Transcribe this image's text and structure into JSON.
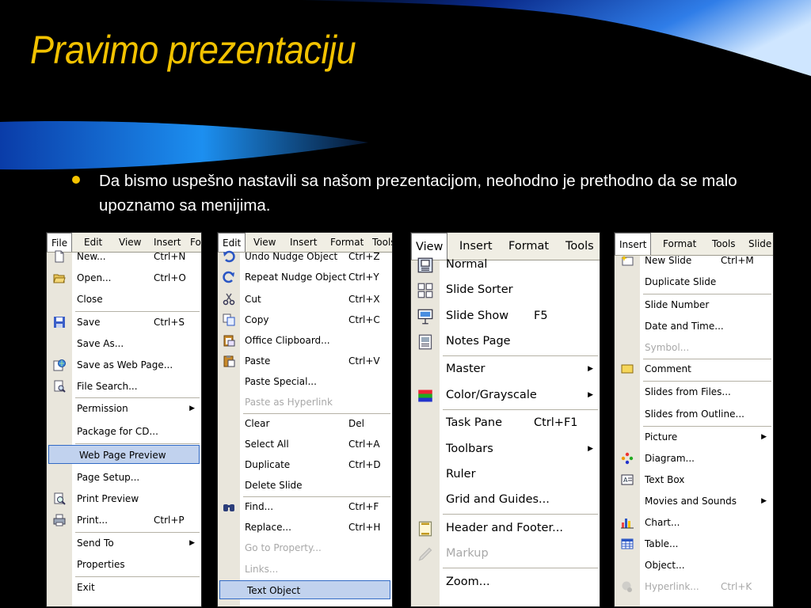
{
  "slide": {
    "title": "Pravimo prezentaciju",
    "bullet": "Da bismo uspešno nastavili sa našom prezentacijom, neohodno je prethodno da se malo upoznamo sa menijima."
  },
  "menus": [
    {
      "bar": [
        "File",
        "Edit",
        "View",
        "Insert",
        "Fo"
      ],
      "items": [
        {
          "label": "New...",
          "shortcut": "Ctrl+N",
          "icon": "new-document-icon"
        },
        {
          "label": "Open...",
          "shortcut": "Ctrl+O",
          "icon": "open-folder-icon"
        },
        {
          "label": "Close",
          "shortcut": ""
        },
        {
          "label": "Save",
          "shortcut": "Ctrl+S",
          "icon": "save-disk-icon"
        },
        {
          "label": "Save As...",
          "shortcut": ""
        },
        {
          "label": "Save as Web Page...",
          "shortcut": "",
          "icon": "web-page-icon"
        },
        {
          "label": "File Search...",
          "shortcut": "",
          "icon": "file-search-icon"
        },
        {
          "label": "Permission",
          "shortcut": "",
          "submenu": true
        },
        {
          "label": "Package for CD...",
          "shortcut": ""
        },
        {
          "label": "Web Page Preview",
          "shortcut": "",
          "highlighted": true
        },
        {
          "label": "Page Setup...",
          "shortcut": ""
        },
        {
          "label": "Print Preview",
          "shortcut": "",
          "icon": "print-preview-icon"
        },
        {
          "label": "Print...",
          "shortcut": "Ctrl+P",
          "icon": "printer-icon"
        },
        {
          "label": "Send To",
          "shortcut": "",
          "submenu": true
        },
        {
          "label": "Properties",
          "shortcut": ""
        },
        {
          "label": "Exit",
          "shortcut": ""
        }
      ]
    },
    {
      "bar": [
        "Edit",
        "View",
        "Insert",
        "Format",
        "Tools"
      ],
      "items": [
        {
          "label": "Undo Nudge Object",
          "shortcut": "Ctrl+Z",
          "icon": "undo-icon"
        },
        {
          "label": "Repeat Nudge Object",
          "shortcut": "Ctrl+Y",
          "icon": "repeat-icon"
        },
        {
          "label": "Cut",
          "shortcut": "Ctrl+X",
          "icon": "scissors-icon"
        },
        {
          "label": "Copy",
          "shortcut": "Ctrl+C",
          "icon": "copy-icon"
        },
        {
          "label": "Office Clipboard...",
          "shortcut": "",
          "icon": "clipboard-icon"
        },
        {
          "label": "Paste",
          "shortcut": "Ctrl+V",
          "icon": "paste-icon"
        },
        {
          "label": "Paste Special...",
          "shortcut": ""
        },
        {
          "label": "Paste as Hyperlink",
          "shortcut": "",
          "disabled": true
        },
        {
          "label": "Clear",
          "shortcut": "Del"
        },
        {
          "label": "Select All",
          "shortcut": "Ctrl+A"
        },
        {
          "label": "Duplicate",
          "shortcut": "Ctrl+D"
        },
        {
          "label": "Delete Slide",
          "shortcut": ""
        },
        {
          "label": "Find...",
          "shortcut": "Ctrl+F",
          "icon": "binoculars-icon"
        },
        {
          "label": "Replace...",
          "shortcut": "Ctrl+H"
        },
        {
          "label": "Go to Property...",
          "shortcut": "",
          "disabled": true
        },
        {
          "label": "Links...",
          "shortcut": "",
          "disabled": true
        },
        {
          "label": "Text Object",
          "shortcut": "",
          "highlighted": true
        }
      ]
    },
    {
      "bar": [
        "View",
        "Insert",
        "Format",
        "Tools"
      ],
      "items": [
        {
          "label": "Normal",
          "shortcut": "",
          "icon": "normal-view-icon"
        },
        {
          "label": "Slide Sorter",
          "shortcut": "",
          "icon": "slide-sorter-icon"
        },
        {
          "label": "Slide Show",
          "shortcut": "F5",
          "icon": "slide-show-icon"
        },
        {
          "label": "Notes Page",
          "shortcut": "",
          "icon": "notes-page-icon"
        },
        {
          "label": "Master",
          "shortcut": "",
          "submenu": true
        },
        {
          "label": "Color/Grayscale",
          "shortcut": "",
          "submenu": true,
          "icon": "color-grayscale-icon"
        },
        {
          "label": "Task Pane",
          "shortcut": "Ctrl+F1"
        },
        {
          "label": "Toolbars",
          "shortcut": "",
          "submenu": true
        },
        {
          "label": "Ruler",
          "shortcut": ""
        },
        {
          "label": "Grid and Guides...",
          "shortcut": ""
        },
        {
          "label": "Header and Footer...",
          "shortcut": "",
          "icon": "header-footer-icon"
        },
        {
          "label": "Markup",
          "shortcut": "",
          "disabled": true,
          "icon": "markup-icon"
        },
        {
          "label": "Zoom...",
          "shortcut": ""
        }
      ]
    },
    {
      "bar": [
        "Insert",
        "Format",
        "Tools",
        "Slide"
      ],
      "items": [
        {
          "label": "New Slide",
          "shortcut": "Ctrl+M",
          "icon": "new-slide-icon"
        },
        {
          "label": "Duplicate Slide",
          "shortcut": ""
        },
        {
          "label": "Slide Number",
          "shortcut": ""
        },
        {
          "label": "Date and Time...",
          "shortcut": ""
        },
        {
          "label": "Symbol...",
          "shortcut": "",
          "disabled": true
        },
        {
          "label": "Comment",
          "shortcut": "",
          "icon": "comment-icon"
        },
        {
          "label": "Slides from Files...",
          "shortcut": ""
        },
        {
          "label": "Slides from Outline...",
          "shortcut": ""
        },
        {
          "label": "Picture",
          "shortcut": "",
          "submenu": true
        },
        {
          "label": "Diagram...",
          "shortcut": "",
          "icon": "diagram-icon"
        },
        {
          "label": "Text Box",
          "shortcut": "",
          "icon": "text-box-icon"
        },
        {
          "label": "Movies and Sounds",
          "shortcut": "",
          "submenu": true
        },
        {
          "label": "Chart...",
          "shortcut": "",
          "icon": "chart-icon"
        },
        {
          "label": "Table...",
          "shortcut": "",
          "icon": "table-icon"
        },
        {
          "label": "Object...",
          "shortcut": ""
        },
        {
          "label": "Hyperlink...",
          "shortcut": "Ctrl+K",
          "disabled": true,
          "icon": "hyperlink-icon"
        }
      ]
    }
  ]
}
